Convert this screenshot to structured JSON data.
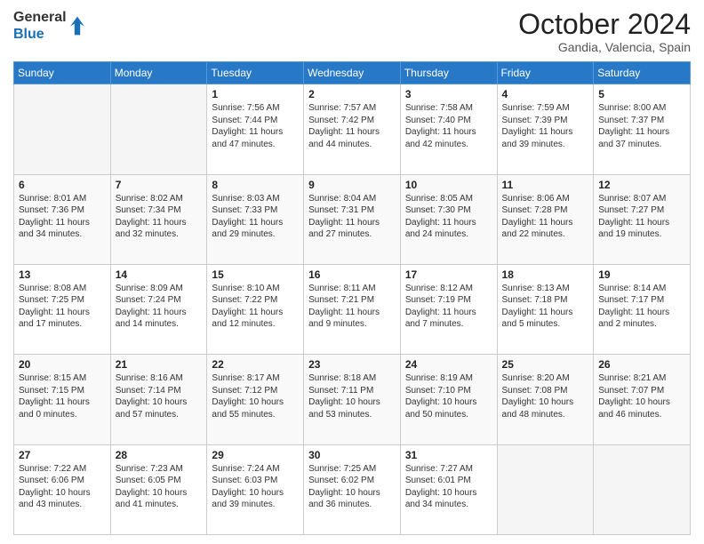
{
  "logo": {
    "line1": "General",
    "line2": "Blue"
  },
  "header": {
    "month": "October 2024",
    "location": "Gandia, Valencia, Spain"
  },
  "weekdays": [
    "Sunday",
    "Monday",
    "Tuesday",
    "Wednesday",
    "Thursday",
    "Friday",
    "Saturday"
  ],
  "weeks": [
    [
      {
        "day": "",
        "detail": ""
      },
      {
        "day": "",
        "detail": ""
      },
      {
        "day": "1",
        "detail": "Sunrise: 7:56 AM\nSunset: 7:44 PM\nDaylight: 11 hours and 47 minutes."
      },
      {
        "day": "2",
        "detail": "Sunrise: 7:57 AM\nSunset: 7:42 PM\nDaylight: 11 hours and 44 minutes."
      },
      {
        "day": "3",
        "detail": "Sunrise: 7:58 AM\nSunset: 7:40 PM\nDaylight: 11 hours and 42 minutes."
      },
      {
        "day": "4",
        "detail": "Sunrise: 7:59 AM\nSunset: 7:39 PM\nDaylight: 11 hours and 39 minutes."
      },
      {
        "day": "5",
        "detail": "Sunrise: 8:00 AM\nSunset: 7:37 PM\nDaylight: 11 hours and 37 minutes."
      }
    ],
    [
      {
        "day": "6",
        "detail": "Sunrise: 8:01 AM\nSunset: 7:36 PM\nDaylight: 11 hours and 34 minutes."
      },
      {
        "day": "7",
        "detail": "Sunrise: 8:02 AM\nSunset: 7:34 PM\nDaylight: 11 hours and 32 minutes."
      },
      {
        "day": "8",
        "detail": "Sunrise: 8:03 AM\nSunset: 7:33 PM\nDaylight: 11 hours and 29 minutes."
      },
      {
        "day": "9",
        "detail": "Sunrise: 8:04 AM\nSunset: 7:31 PM\nDaylight: 11 hours and 27 minutes."
      },
      {
        "day": "10",
        "detail": "Sunrise: 8:05 AM\nSunset: 7:30 PM\nDaylight: 11 hours and 24 minutes."
      },
      {
        "day": "11",
        "detail": "Sunrise: 8:06 AM\nSunset: 7:28 PM\nDaylight: 11 hours and 22 minutes."
      },
      {
        "day": "12",
        "detail": "Sunrise: 8:07 AM\nSunset: 7:27 PM\nDaylight: 11 hours and 19 minutes."
      }
    ],
    [
      {
        "day": "13",
        "detail": "Sunrise: 8:08 AM\nSunset: 7:25 PM\nDaylight: 11 hours and 17 minutes."
      },
      {
        "day": "14",
        "detail": "Sunrise: 8:09 AM\nSunset: 7:24 PM\nDaylight: 11 hours and 14 minutes."
      },
      {
        "day": "15",
        "detail": "Sunrise: 8:10 AM\nSunset: 7:22 PM\nDaylight: 11 hours and 12 minutes."
      },
      {
        "day": "16",
        "detail": "Sunrise: 8:11 AM\nSunset: 7:21 PM\nDaylight: 11 hours and 9 minutes."
      },
      {
        "day": "17",
        "detail": "Sunrise: 8:12 AM\nSunset: 7:19 PM\nDaylight: 11 hours and 7 minutes."
      },
      {
        "day": "18",
        "detail": "Sunrise: 8:13 AM\nSunset: 7:18 PM\nDaylight: 11 hours and 5 minutes."
      },
      {
        "day": "19",
        "detail": "Sunrise: 8:14 AM\nSunset: 7:17 PM\nDaylight: 11 hours and 2 minutes."
      }
    ],
    [
      {
        "day": "20",
        "detail": "Sunrise: 8:15 AM\nSunset: 7:15 PM\nDaylight: 11 hours and 0 minutes."
      },
      {
        "day": "21",
        "detail": "Sunrise: 8:16 AM\nSunset: 7:14 PM\nDaylight: 10 hours and 57 minutes."
      },
      {
        "day": "22",
        "detail": "Sunrise: 8:17 AM\nSunset: 7:12 PM\nDaylight: 10 hours and 55 minutes."
      },
      {
        "day": "23",
        "detail": "Sunrise: 8:18 AM\nSunset: 7:11 PM\nDaylight: 10 hours and 53 minutes."
      },
      {
        "day": "24",
        "detail": "Sunrise: 8:19 AM\nSunset: 7:10 PM\nDaylight: 10 hours and 50 minutes."
      },
      {
        "day": "25",
        "detail": "Sunrise: 8:20 AM\nSunset: 7:08 PM\nDaylight: 10 hours and 48 minutes."
      },
      {
        "day": "26",
        "detail": "Sunrise: 8:21 AM\nSunset: 7:07 PM\nDaylight: 10 hours and 46 minutes."
      }
    ],
    [
      {
        "day": "27",
        "detail": "Sunrise: 7:22 AM\nSunset: 6:06 PM\nDaylight: 10 hours and 43 minutes."
      },
      {
        "day": "28",
        "detail": "Sunrise: 7:23 AM\nSunset: 6:05 PM\nDaylight: 10 hours and 41 minutes."
      },
      {
        "day": "29",
        "detail": "Sunrise: 7:24 AM\nSunset: 6:03 PM\nDaylight: 10 hours and 39 minutes."
      },
      {
        "day": "30",
        "detail": "Sunrise: 7:25 AM\nSunset: 6:02 PM\nDaylight: 10 hours and 36 minutes."
      },
      {
        "day": "31",
        "detail": "Sunrise: 7:27 AM\nSunset: 6:01 PM\nDaylight: 10 hours and 34 minutes."
      },
      {
        "day": "",
        "detail": ""
      },
      {
        "day": "",
        "detail": ""
      }
    ]
  ]
}
